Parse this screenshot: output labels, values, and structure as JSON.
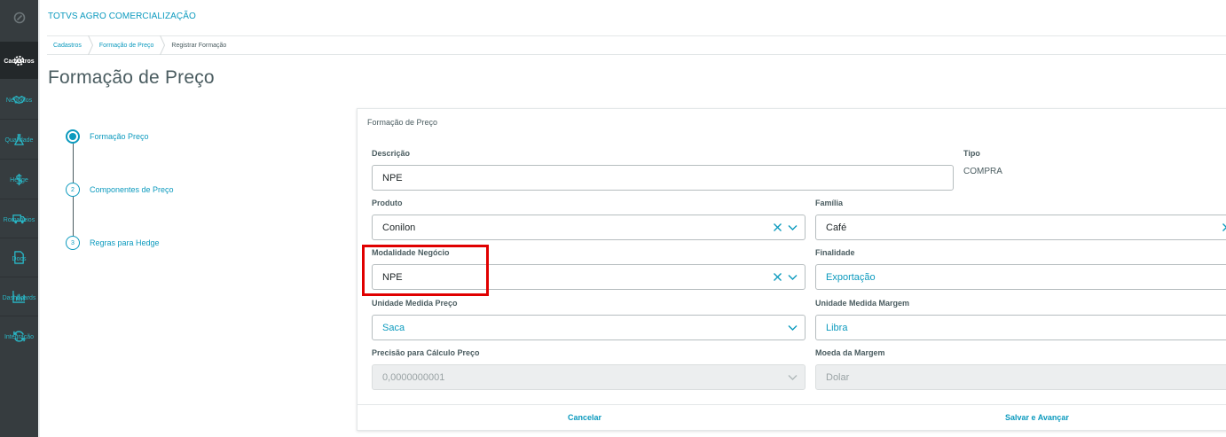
{
  "app": {
    "title": "TOTVS AGRO COMERCIALIZAÇÃO"
  },
  "sidebar": {
    "items": [
      {
        "label": "Cadastros",
        "icon": "gear-icon"
      },
      {
        "label": "Negócios",
        "icon": "handshake-icon"
      },
      {
        "label": "Qualidade",
        "icon": "flask-icon"
      },
      {
        "label": "Hedge",
        "icon": "dollar-icon"
      },
      {
        "label": "Romaneios",
        "icon": "truck-icon"
      },
      {
        "label": "Docs",
        "icon": "document-icon"
      },
      {
        "label": "Dashboards",
        "icon": "bar-chart-icon"
      },
      {
        "label": "Integração",
        "icon": "sync-icon"
      }
    ]
  },
  "breadcrumb": [
    "Cadastros",
    "Formação de Preço",
    "Registrar Formação"
  ],
  "page": {
    "title": "Formação de Preço"
  },
  "stepper": {
    "steps": [
      {
        "number": "",
        "label": "Formação Preço"
      },
      {
        "number": "2",
        "label": "Componentes de Preço"
      },
      {
        "number": "3",
        "label": "Regras para Hedge"
      }
    ]
  },
  "form": {
    "title": "Formação de Preço",
    "descricao": {
      "label": "Descrição",
      "value": "NPE"
    },
    "tipo": {
      "label": "Tipo",
      "value": "COMPRA"
    },
    "produto": {
      "label": "Produto",
      "value": "Conilon"
    },
    "familia": {
      "label": "Família",
      "value": "Café"
    },
    "modalidade": {
      "label": "Modalidade Negócio",
      "value": "NPE"
    },
    "finalidade": {
      "label": "Finalidade",
      "value": "Exportação"
    },
    "unidade_preco": {
      "label": "Unidade Medida Preço",
      "value": "Saca"
    },
    "unidade_margem": {
      "label": "Unidade Medida Margem",
      "value": "Libra"
    },
    "precisao": {
      "label": "Precisão para Cálculo Preço",
      "value": "0,0000000001"
    },
    "moeda": {
      "label": "Moeda da Margem",
      "value": "Dolar"
    },
    "cancel_label": "Cancelar",
    "save_label": "Salvar e Avançar"
  },
  "colors": {
    "accent": "#0c9abe",
    "sidebar": "#363c3f",
    "highlight": "#e00000"
  }
}
